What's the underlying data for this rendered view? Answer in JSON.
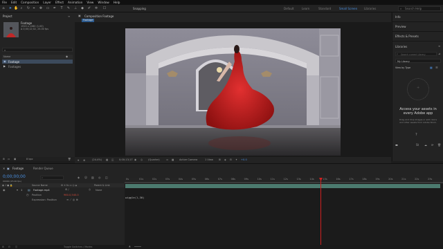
{
  "menu": [
    "File",
    "Edit",
    "Composition",
    "Layer",
    "Effect",
    "Animation",
    "View",
    "Window",
    "Help"
  ],
  "toolbar": {
    "snapping_label": "Snapping",
    "workspaces": [
      "Default",
      "Learn",
      "Standard",
      "Small Screen",
      "Libraries"
    ],
    "active_workspace": "Small Screen",
    "search_placeholder": "Search Help"
  },
  "project": {
    "tab": "Project",
    "item_name": "Footage",
    "item_info_1": "1920 x 1080 (1.00)",
    "item_info_2": "Δ 0;00;12;02, 25.00 fps",
    "rows": [
      {
        "name": "Footage",
        "icon": "composition-icon"
      },
      {
        "name": "Footages",
        "icon": "folder-icon"
      }
    ],
    "bpc": "8 bpc"
  },
  "composition": {
    "tab": "Composition Footage",
    "subtab": "Footage",
    "zoom": "(24.4%)",
    "time": "0;00;13;17",
    "resolution": "(Quarter)",
    "camera": "Active Camera",
    "views": "1 View",
    "exposure": "+0.0"
  },
  "right_panel": {
    "sections": [
      "Info",
      "Preview",
      "Effects & Presets",
      "Libraries"
    ],
    "libraries_search_placeholder": "Search current Library",
    "library": "My Library",
    "view_by": "View by Type",
    "empty_title": "Access your assets in every Adobe app",
    "empty_body": "Drag and drop images or add colors and other assets from Adobe Stock."
  },
  "timeline": {
    "tabs": [
      "Footage",
      "Render Queue"
    ],
    "timecode": "0;00;00;00",
    "fps": "00000 (25.00 fps)",
    "columns": [
      "Source Name",
      "Parent & Link"
    ],
    "layer_index": "1",
    "layer_name": "Footage.mp4",
    "parent": "None",
    "property": "Position",
    "position_value": "960.0,540.0",
    "expression_label": "Expression: Position",
    "expression_text": "wiggle(1,30)",
    "ruler": [
      "0s",
      "01s",
      "02s",
      "03s",
      "04s",
      "05s",
      "06s",
      "07s",
      "08s",
      "09s",
      "10s",
      "11s",
      "12s",
      "13s",
      "14s",
      "15s",
      "16s",
      "17s",
      "18s",
      "19s",
      "20s",
      "21s",
      "22s",
      "23s"
    ],
    "toggle_label": "Toggle Switches / Modes"
  },
  "colors": {
    "accent": "#4a90e2",
    "playhead": "#d02020",
    "layer_bar": "#4c7a6f"
  }
}
